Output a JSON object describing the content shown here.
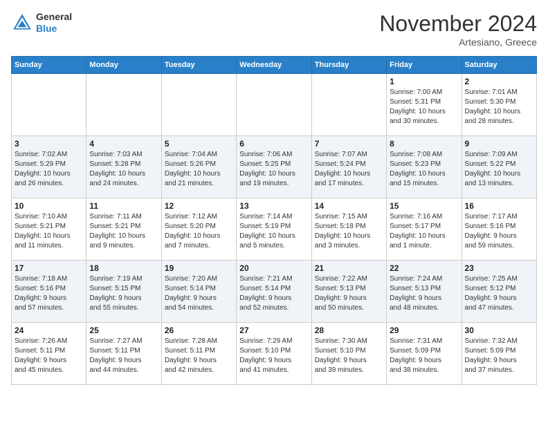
{
  "header": {
    "logo_line1": "General",
    "logo_line2": "Blue",
    "month": "November 2024",
    "location": "Artesiano, Greece"
  },
  "days_of_week": [
    "Sunday",
    "Monday",
    "Tuesday",
    "Wednesday",
    "Thursday",
    "Friday",
    "Saturday"
  ],
  "weeks": [
    [
      {
        "day": "",
        "info": ""
      },
      {
        "day": "",
        "info": ""
      },
      {
        "day": "",
        "info": ""
      },
      {
        "day": "",
        "info": ""
      },
      {
        "day": "",
        "info": ""
      },
      {
        "day": "1",
        "info": "Sunrise: 7:00 AM\nSunset: 5:31 PM\nDaylight: 10 hours\nand 30 minutes."
      },
      {
        "day": "2",
        "info": "Sunrise: 7:01 AM\nSunset: 5:30 PM\nDaylight: 10 hours\nand 28 minutes."
      }
    ],
    [
      {
        "day": "3",
        "info": "Sunrise: 7:02 AM\nSunset: 5:29 PM\nDaylight: 10 hours\nand 26 minutes."
      },
      {
        "day": "4",
        "info": "Sunrise: 7:03 AM\nSunset: 5:28 PM\nDaylight: 10 hours\nand 24 minutes."
      },
      {
        "day": "5",
        "info": "Sunrise: 7:04 AM\nSunset: 5:26 PM\nDaylight: 10 hours\nand 21 minutes."
      },
      {
        "day": "6",
        "info": "Sunrise: 7:06 AM\nSunset: 5:25 PM\nDaylight: 10 hours\nand 19 minutes."
      },
      {
        "day": "7",
        "info": "Sunrise: 7:07 AM\nSunset: 5:24 PM\nDaylight: 10 hours\nand 17 minutes."
      },
      {
        "day": "8",
        "info": "Sunrise: 7:08 AM\nSunset: 5:23 PM\nDaylight: 10 hours\nand 15 minutes."
      },
      {
        "day": "9",
        "info": "Sunrise: 7:09 AM\nSunset: 5:22 PM\nDaylight: 10 hours\nand 13 minutes."
      }
    ],
    [
      {
        "day": "10",
        "info": "Sunrise: 7:10 AM\nSunset: 5:21 PM\nDaylight: 10 hours\nand 11 minutes."
      },
      {
        "day": "11",
        "info": "Sunrise: 7:11 AM\nSunset: 5:21 PM\nDaylight: 10 hours\nand 9 minutes."
      },
      {
        "day": "12",
        "info": "Sunrise: 7:12 AM\nSunset: 5:20 PM\nDaylight: 10 hours\nand 7 minutes."
      },
      {
        "day": "13",
        "info": "Sunrise: 7:14 AM\nSunset: 5:19 PM\nDaylight: 10 hours\nand 5 minutes."
      },
      {
        "day": "14",
        "info": "Sunrise: 7:15 AM\nSunset: 5:18 PM\nDaylight: 10 hours\nand 3 minutes."
      },
      {
        "day": "15",
        "info": "Sunrise: 7:16 AM\nSunset: 5:17 PM\nDaylight: 10 hours\nand 1 minute."
      },
      {
        "day": "16",
        "info": "Sunrise: 7:17 AM\nSunset: 5:16 PM\nDaylight: 9 hours\nand 59 minutes."
      }
    ],
    [
      {
        "day": "17",
        "info": "Sunrise: 7:18 AM\nSunset: 5:16 PM\nDaylight: 9 hours\nand 57 minutes."
      },
      {
        "day": "18",
        "info": "Sunrise: 7:19 AM\nSunset: 5:15 PM\nDaylight: 9 hours\nand 55 minutes."
      },
      {
        "day": "19",
        "info": "Sunrise: 7:20 AM\nSunset: 5:14 PM\nDaylight: 9 hours\nand 54 minutes."
      },
      {
        "day": "20",
        "info": "Sunrise: 7:21 AM\nSunset: 5:14 PM\nDaylight: 9 hours\nand 52 minutes."
      },
      {
        "day": "21",
        "info": "Sunrise: 7:22 AM\nSunset: 5:13 PM\nDaylight: 9 hours\nand 50 minutes."
      },
      {
        "day": "22",
        "info": "Sunrise: 7:24 AM\nSunset: 5:13 PM\nDaylight: 9 hours\nand 48 minutes."
      },
      {
        "day": "23",
        "info": "Sunrise: 7:25 AM\nSunset: 5:12 PM\nDaylight: 9 hours\nand 47 minutes."
      }
    ],
    [
      {
        "day": "24",
        "info": "Sunrise: 7:26 AM\nSunset: 5:11 PM\nDaylight: 9 hours\nand 45 minutes."
      },
      {
        "day": "25",
        "info": "Sunrise: 7:27 AM\nSunset: 5:11 PM\nDaylight: 9 hours\nand 44 minutes."
      },
      {
        "day": "26",
        "info": "Sunrise: 7:28 AM\nSunset: 5:11 PM\nDaylight: 9 hours\nand 42 minutes."
      },
      {
        "day": "27",
        "info": "Sunrise: 7:29 AM\nSunset: 5:10 PM\nDaylight: 9 hours\nand 41 minutes."
      },
      {
        "day": "28",
        "info": "Sunrise: 7:30 AM\nSunset: 5:10 PM\nDaylight: 9 hours\nand 39 minutes."
      },
      {
        "day": "29",
        "info": "Sunrise: 7:31 AM\nSunset: 5:09 PM\nDaylight: 9 hours\nand 38 minutes."
      },
      {
        "day": "30",
        "info": "Sunrise: 7:32 AM\nSunset: 5:09 PM\nDaylight: 9 hours\nand 37 minutes."
      }
    ]
  ]
}
